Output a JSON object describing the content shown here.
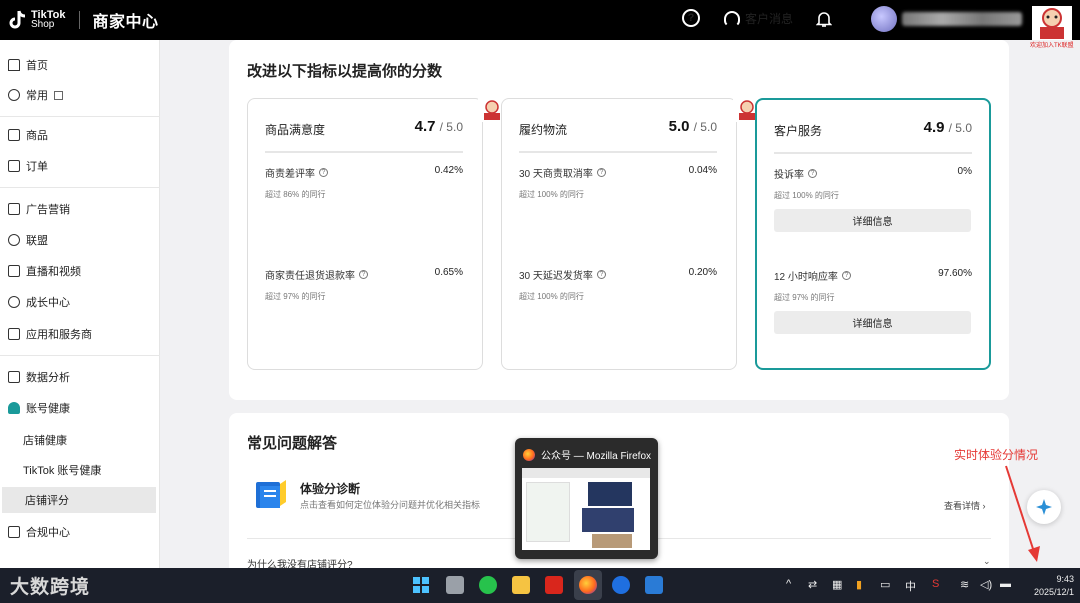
{
  "topbar": {
    "logo_line1": "TikTok",
    "logo_line2": "Shop",
    "brand": "商家中心",
    "help_icon": "?",
    "messages": "客户消息",
    "mascot_caption": "欢迎加入TK联盟"
  },
  "sidebar": {
    "items": [
      {
        "label": "首页",
        "icon": "home-icon"
      },
      {
        "label": "常用",
        "icon": "plus-circle-icon"
      },
      {
        "label": "商品",
        "icon": "product-icon"
      },
      {
        "label": "订单",
        "icon": "order-icon"
      },
      {
        "label": "广告营销",
        "icon": "megaphone-icon"
      },
      {
        "label": "联盟",
        "icon": "affiliate-icon"
      },
      {
        "label": "直播和视频",
        "icon": "video-icon"
      },
      {
        "label": "成长中心",
        "icon": "growth-icon"
      },
      {
        "label": "应用和服务商",
        "icon": "apps-icon"
      },
      {
        "label": "数据分析",
        "icon": "chart-icon"
      },
      {
        "label": "账号健康",
        "icon": "trophy-icon"
      },
      {
        "label": "合规中心",
        "icon": "compliance-icon"
      }
    ],
    "sub_items": [
      "店铺健康",
      "TikTok 账号健康",
      "店铺评分"
    ]
  },
  "main": {
    "title": "改进以下指标以提高你的分数",
    "cards": [
      {
        "name": "商品满意度",
        "score": "4.7",
        "max": "/ 5.0",
        "metrics": [
          {
            "name": "商责差评率",
            "value": "0.42%",
            "sub": "超过 86% 的同行"
          },
          {
            "name": "商家责任退货退款率",
            "value": "0.65%",
            "sub": "超过 97% 的同行"
          }
        ]
      },
      {
        "name": "履约物流",
        "score": "5.0",
        "max": "/ 5.0",
        "metrics": [
          {
            "name": "30 天商责取消率",
            "value": "0.04%",
            "sub": "超过 100% 的同行"
          },
          {
            "name": "30 天延迟发货率",
            "value": "0.20%",
            "sub": "超过 100% 的同行"
          }
        ]
      },
      {
        "name": "客户服务",
        "score": "4.9",
        "max": "/ 5.0",
        "metrics": [
          {
            "name": "投诉率",
            "value": "0%",
            "sub": "超过 100% 的同行",
            "button": "详细信息"
          },
          {
            "name": "12 小时响应率",
            "value": "97.60%",
            "sub": "超过 97% 的同行",
            "button": "详细信息"
          }
        ]
      }
    ]
  },
  "faq": {
    "title": "常见问题解答",
    "item_title": "体验分诊断",
    "item_desc": "点击查看如何定位体验分问题并优化相关指标",
    "item_link": "查看详情 ›",
    "question": "为什么我没有店铺评分?"
  },
  "firefox_preview": {
    "title": "公众号 — Mozilla Firefox"
  },
  "annotation": "实时体验分情况",
  "watermark": "大数跨境",
  "taskbar": {
    "tray_ime": "中",
    "time": "9:43",
    "date": "2025/12/1"
  },
  "colors": {
    "accent": "#1a9a9a",
    "annotation": "#e53935",
    "topbar": "#000000"
  }
}
